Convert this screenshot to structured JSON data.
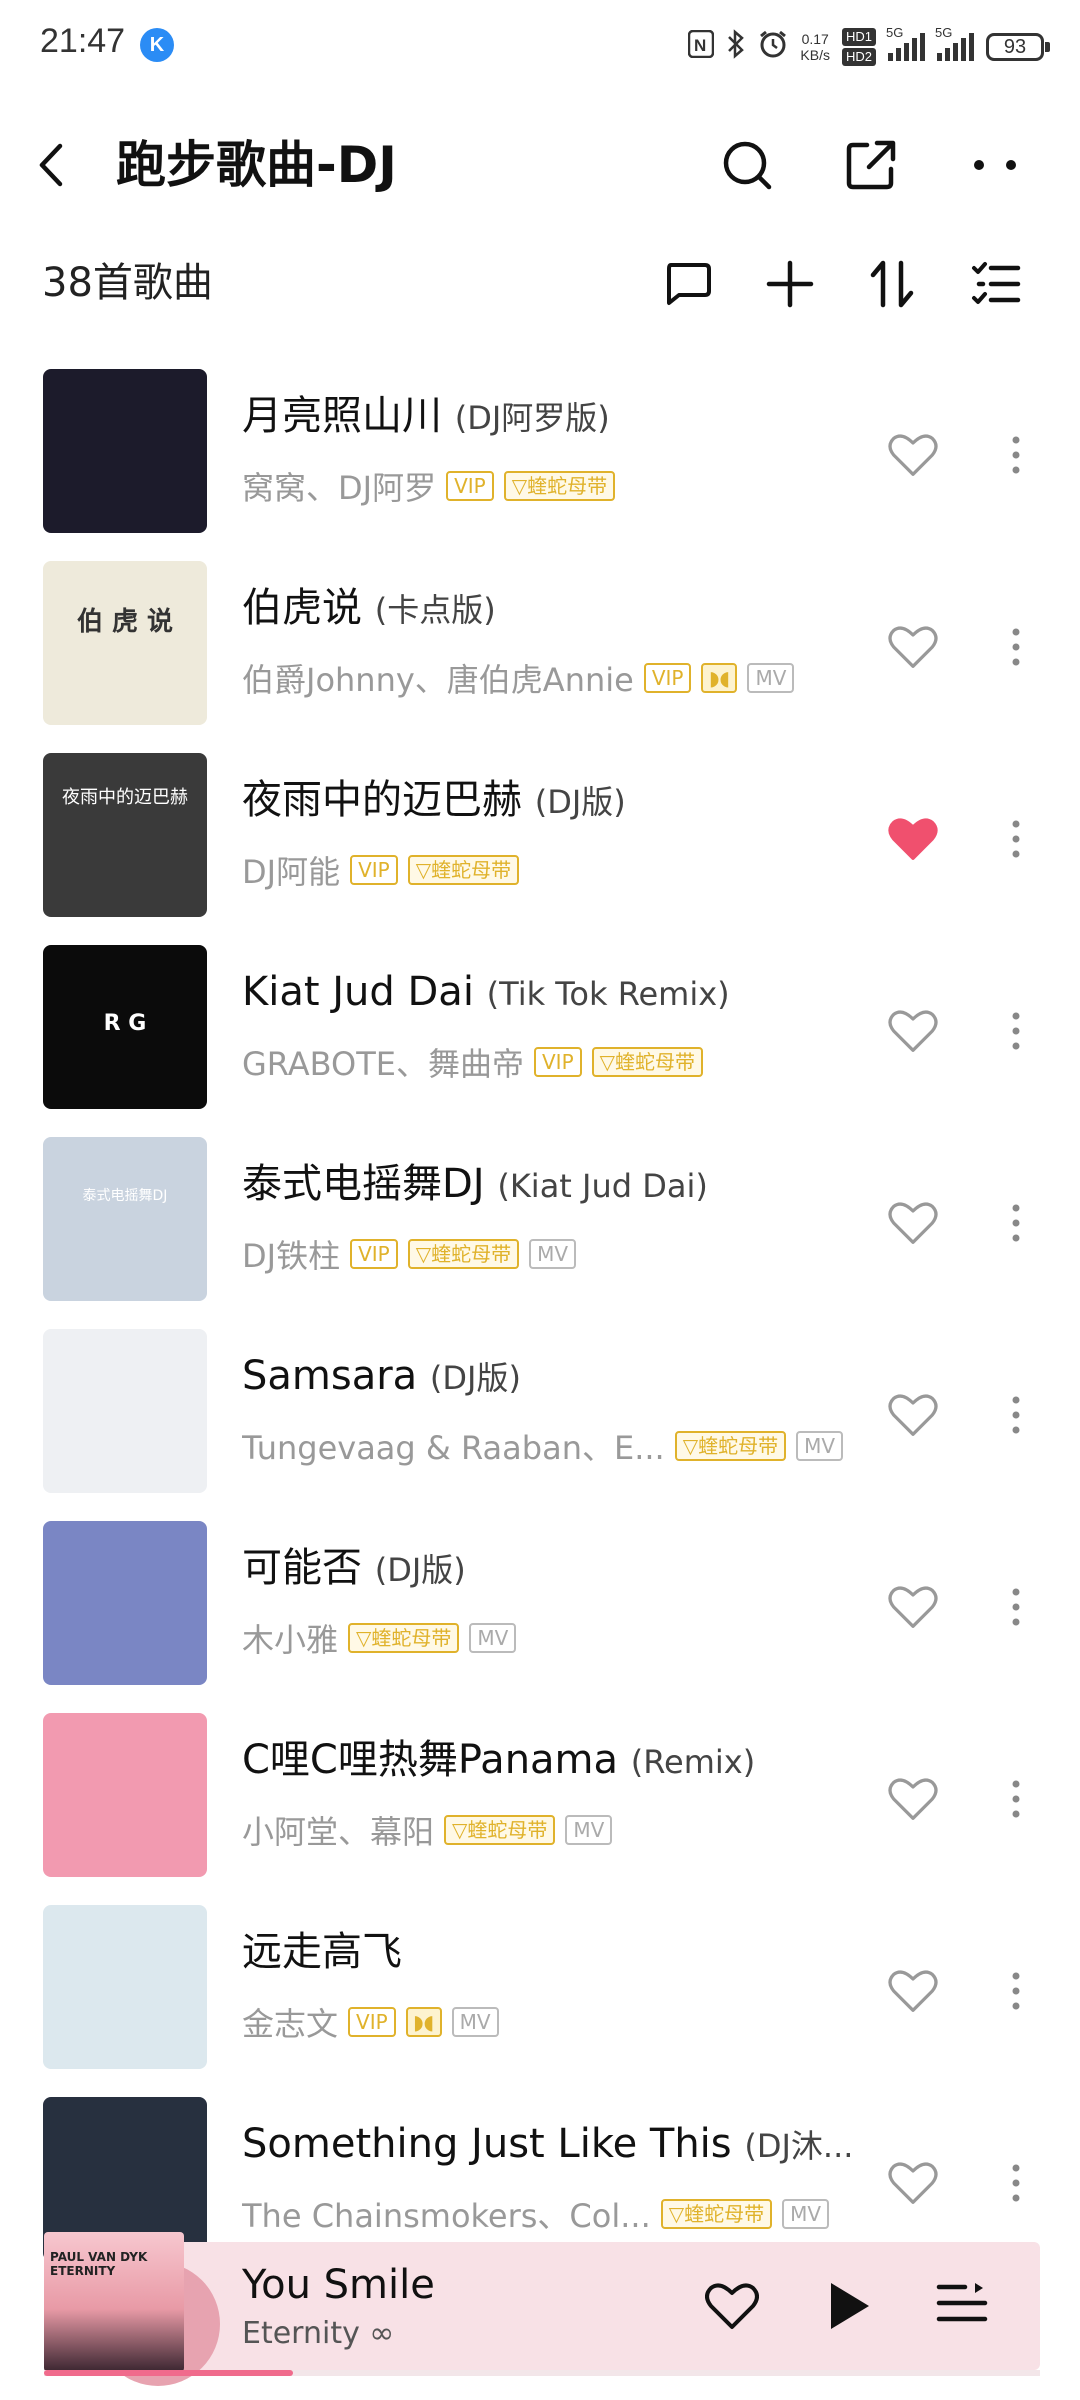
{
  "status_bar": {
    "time": "21:47",
    "app_badge": "K",
    "net_speed_value": "0.17",
    "net_speed_unit": "KB/s",
    "hd1": "HD1",
    "hd2": "HD2",
    "signal1_label": "5G",
    "signal2_label": "5G",
    "battery": "93"
  },
  "header": {
    "title": "跑步歌曲-DJ",
    "icons": [
      "back-icon",
      "search-icon",
      "share-icon",
      "more-icon"
    ]
  },
  "toolbar": {
    "song_count": "38首歌曲",
    "icons": [
      "comment-icon",
      "add-icon",
      "sort-icon",
      "multi-select-icon"
    ]
  },
  "songs": [
    {
      "title": "月亮照山川",
      "version": "(DJ阿罗版)",
      "artist": "窝窝、DJ阿罗",
      "tags": [
        "VIP",
        "蝰蛇母带"
      ],
      "liked": false,
      "cover_color": "#1c1b2b"
    },
    {
      "title": "伯虎说",
      "version": "(卡点版)",
      "artist": "伯爵Johnny、唐伯虎Annie",
      "tags": [
        "VIP",
        "audio",
        "MV"
      ],
      "liked": false,
      "cover_color": "#eeeadb"
    },
    {
      "title": "夜雨中的迈巴赫",
      "version": "(DJ版)",
      "artist": "DJ阿能",
      "tags": [
        "VIP",
        "蝰蛇母带"
      ],
      "liked": true,
      "cover_color": "#3a3a3a"
    },
    {
      "title": "Kiat Jud Dai",
      "version": "(Tik Tok Remix)",
      "artist": "GRABOTE、舞曲帝",
      "tags": [
        "VIP",
        "蝰蛇母带"
      ],
      "liked": false,
      "cover_color": "#0b0b0b"
    },
    {
      "title": "泰式电摇舞DJ",
      "version": "(Kiat Jud Dai)",
      "artist": "DJ铁柱",
      "tags": [
        "VIP",
        "蝰蛇母带",
        "MV"
      ],
      "liked": false,
      "cover_color": "#c9d3df"
    },
    {
      "title": "Samsara",
      "version": "(DJ版)",
      "artist": "Tungevaag & Raaban、E...",
      "tags": [
        "蝰蛇母带",
        "MV"
      ],
      "liked": false,
      "cover_color": "#eef0f3"
    },
    {
      "title": "可能否",
      "version": "(DJ版)",
      "artist": "木小雅",
      "tags": [
        "蝰蛇母带",
        "MV"
      ],
      "liked": false,
      "cover_color": "#7a86c4"
    },
    {
      "title": "C哩C哩热舞Panama",
      "version": "(Remix)",
      "artist": "小阿堂、幕阳",
      "tags": [
        "蝰蛇母带",
        "MV"
      ],
      "liked": false,
      "cover_color": "#f29ab0"
    },
    {
      "title": "远走高飞",
      "version": "",
      "artist": "金志文",
      "tags": [
        "VIP",
        "audio",
        "MV"
      ],
      "liked": false,
      "cover_color": "#dce8ee"
    },
    {
      "title": "Something Just Like This",
      "version": "(DJ沐...",
      "artist": "The Chainsmokers、Col...",
      "tags": [
        "蝰蛇母带",
        "MV"
      ],
      "liked": false,
      "cover_color": "#27303f"
    }
  ],
  "cover_texts": {
    "song2": "伯 虎 说",
    "song3": "夜雨中的迈巴赫",
    "song4": "R  G",
    "song5": "泰式电摇舞DJ"
  },
  "player": {
    "title": "You Smile",
    "subtitle": "Eternity ∞",
    "cover_text": "PAUL VAN DYK ETERNITY",
    "progress": 0.25,
    "icons": [
      "heart-icon",
      "play-icon",
      "playlist-icon"
    ]
  },
  "colors": {
    "accent": "#f0506e",
    "vip_gold": "#e0b22b",
    "player_bg": "#f8e1e6"
  }
}
